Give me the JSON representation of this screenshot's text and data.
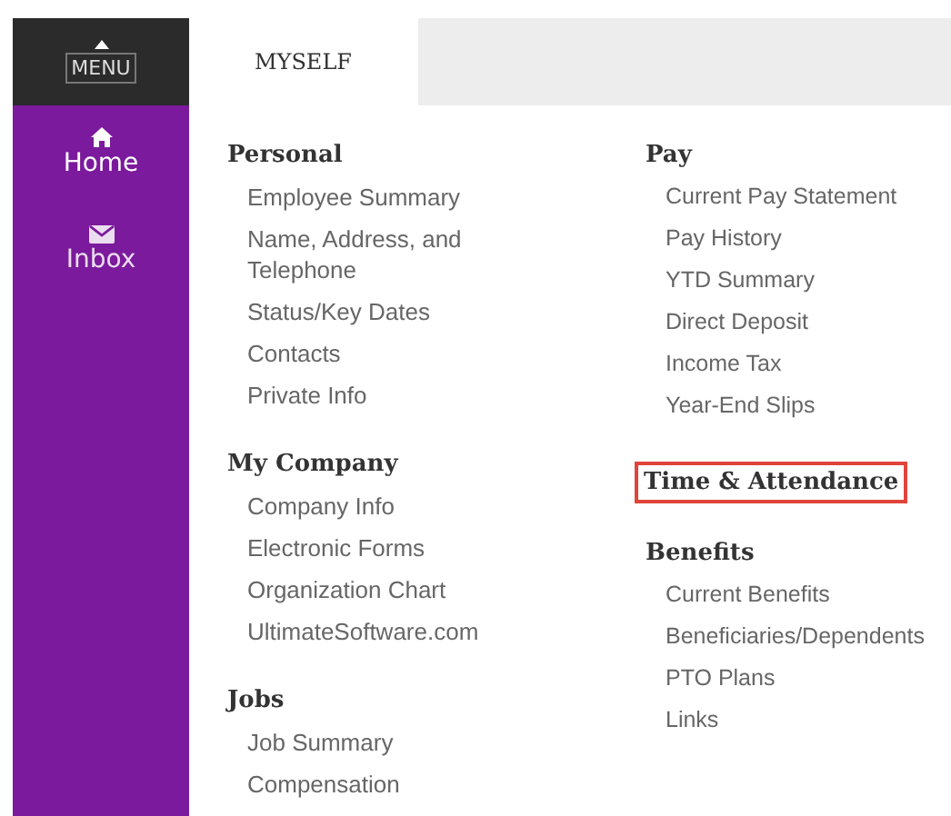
{
  "menu_button": {
    "label": "MENU"
  },
  "sidebar": {
    "items": [
      {
        "label": "Home",
        "kind": "home",
        "selected": true
      },
      {
        "label": "Inbox",
        "kind": "inbox",
        "selected": false
      }
    ]
  },
  "tabs": [
    {
      "label": "MYSELF",
      "selected": true
    }
  ],
  "columns": [
    {
      "sections": [
        {
          "heading": "Personal",
          "highlighted": false,
          "items": [
            "Employee Summary",
            "Name, Address, and Telephone",
            "Status/Key Dates",
            "Contacts",
            "Private Info"
          ]
        },
        {
          "heading": "My Company",
          "highlighted": false,
          "items": [
            "Company Info",
            "Electronic Forms",
            "Organization Chart",
            "UltimateSoftware.com"
          ]
        },
        {
          "heading": "Jobs",
          "highlighted": false,
          "items": [
            "Job Summary",
            "Compensation"
          ]
        }
      ]
    },
    {
      "sections": [
        {
          "heading": "Pay",
          "highlighted": false,
          "items": [
            "Current Pay Statement",
            "Pay History",
            "YTD Summary",
            "Direct Deposit",
            "Income Tax",
            "Year-End Slips"
          ]
        },
        {
          "heading": "Time & Attendance",
          "highlighted": true
        },
        {
          "heading": "Benefits",
          "highlighted": false,
          "items": [
            "Current Benefits",
            "Beneficiaries/Dependents",
            "PTO Plans",
            "Links"
          ]
        }
      ]
    }
  ]
}
